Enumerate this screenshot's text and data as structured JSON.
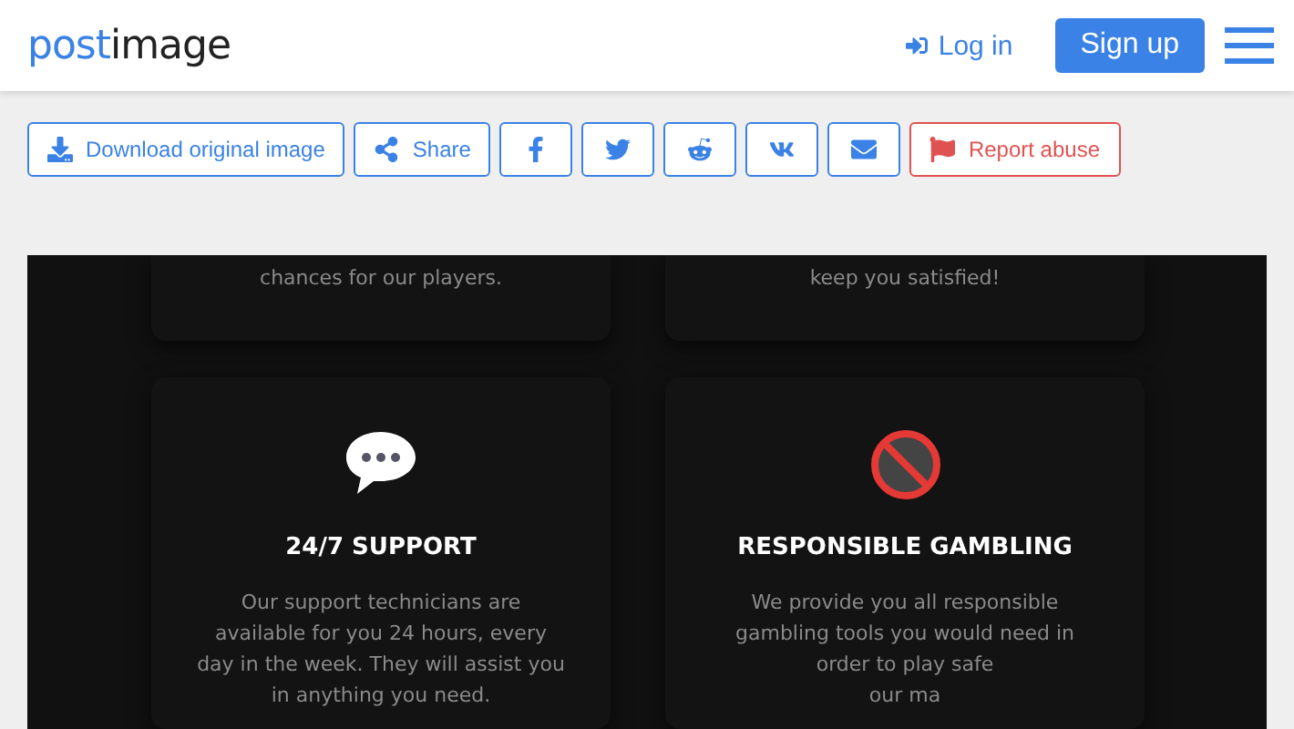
{
  "header": {
    "logo": {
      "part_1": "post",
      "part_2": "image"
    },
    "login": "Log in",
    "signup": "Sign up"
  },
  "actions": [
    {
      "kind": "download",
      "label": "Download original image"
    },
    {
      "kind": "share",
      "label": "Share"
    },
    {
      "kind": "facebook"
    },
    {
      "kind": "twitter"
    },
    {
      "kind": "reddit"
    },
    {
      "kind": "vk"
    },
    {
      "kind": "email"
    },
    {
      "kind": "report",
      "label": "Report abuse"
    }
  ],
  "image": {
    "top_cards": [
      {
        "text_lines": [
          "chances for our players."
        ]
      },
      {
        "text_lines": [
          "keep you satisfied!"
        ]
      }
    ],
    "cards": [
      {
        "kind": "speech",
        "title": "24/7 SUPPORT",
        "text_lines": [
          "Our support technicians are",
          "available for you 24 hours, every",
          "day in the week. They will assist you",
          "in anything you need."
        ]
      },
      {
        "kind": "under18",
        "title": "RESPONSIBLE GAMBLING",
        "text_lines": [
          "We provide you all responsible",
          "gambling tools you would need in",
          "order to play safe",
          "our ma"
        ]
      }
    ]
  }
}
